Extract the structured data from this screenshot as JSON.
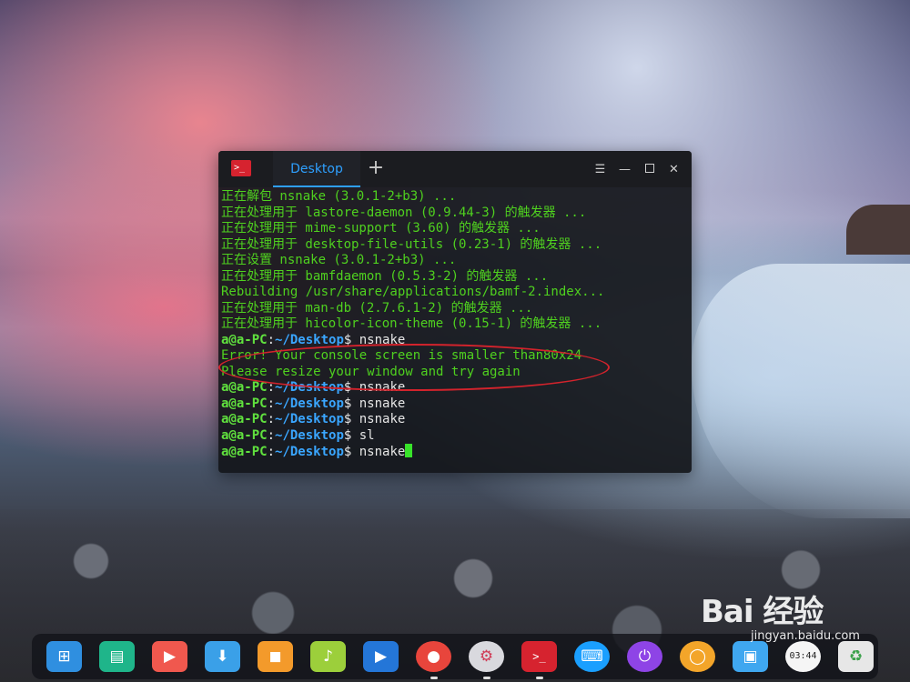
{
  "terminal": {
    "tab_title": "Desktop",
    "add_tab": "+",
    "controls": {
      "menu": "☰",
      "minimize": "—",
      "close": "✕"
    },
    "output_lines": [
      "正在解包 nsnake (3.0.1-2+b3) ...",
      "正在处理用于 lastore-daemon (0.9.44-3) 的触发器 ...",
      "正在处理用于 mime-support (3.60) 的触发器 ...",
      "正在处理用于 desktop-file-utils (0.23-1) 的触发器 ...",
      "正在设置 nsnake (3.0.1-2+b3) ...",
      "正在处理用于 bamfdaemon (0.5.3-2) 的触发器 ...",
      "Rebuilding /usr/share/applications/bamf-2.index...",
      "正在处理用于 man-db (2.7.6.1-2) 的触发器 ...",
      "正在处理用于 hicolor-icon-theme (0.15-1) 的触发器 ..."
    ],
    "prompt_user": "a@a-PC",
    "prompt_sep": ":",
    "prompt_path": "~/Desktop",
    "prompt_symbol": "$ ",
    "session": [
      {
        "type": "prompt",
        "cmd": "nsnake"
      },
      {
        "type": "output",
        "text": "Error! Your console screen is smaller than80x24"
      },
      {
        "type": "output",
        "text": "Please resize your window and try again"
      },
      {
        "type": "prompt",
        "cmd": "nsnake"
      },
      {
        "type": "prompt",
        "cmd": "nsnake"
      },
      {
        "type": "prompt",
        "cmd": "nsnake"
      },
      {
        "type": "prompt",
        "cmd": "sl"
      },
      {
        "type": "prompt",
        "cmd": "nsnake",
        "cursor": true
      }
    ]
  },
  "dock": {
    "items": [
      {
        "name": "launcher",
        "icon": "grid-icon",
        "color": "#2f8fe0",
        "glyph": "⊞"
      },
      {
        "name": "file-manager",
        "icon": "folder-icon",
        "color": "#1fb58a",
        "glyph": "▤"
      },
      {
        "name": "screen-recorder",
        "icon": "recorder-icon",
        "color": "#f0584e",
        "glyph": "▶"
      },
      {
        "name": "app-store",
        "icon": "store-icon",
        "color": "#3aa0e8",
        "glyph": "⬇"
      },
      {
        "name": "shop",
        "icon": "bag-icon",
        "color": "#f39a2b",
        "glyph": "◼"
      },
      {
        "name": "music",
        "icon": "music-icon",
        "color": "#9ccf3b",
        "glyph": "♪"
      },
      {
        "name": "video",
        "icon": "film-icon",
        "color": "#2476d8",
        "glyph": "▶"
      },
      {
        "name": "chrome",
        "icon": "chrome-icon",
        "color": "#e8453c",
        "glyph": "●"
      },
      {
        "name": "settings",
        "icon": "gear-icon",
        "color": "#d9d9de",
        "glyph": "⚙"
      },
      {
        "name": "terminal",
        "icon": "terminal-icon",
        "color": "#d6232f",
        "glyph": ">_"
      },
      {
        "name": "input-method",
        "icon": "keyboard-icon",
        "color": "#1a9fff",
        "glyph": "⌨"
      },
      {
        "name": "shutdown",
        "icon": "power-icon",
        "color": "#8e44e6",
        "glyph": "⏻"
      },
      {
        "name": "browser",
        "icon": "orange-circle-icon",
        "color": "#f3a52a",
        "glyph": "◯"
      },
      {
        "name": "image-viewer",
        "icon": "picture-icon",
        "color": "#3fa7f0",
        "glyph": "▣"
      },
      {
        "name": "clock",
        "icon": "clock-icon",
        "color": "#f5f5f5",
        "glyph": "03:44"
      },
      {
        "name": "trash",
        "icon": "trash-icon",
        "color": "#e7e7e7",
        "glyph": "♻"
      }
    ]
  },
  "watermark": {
    "main": "Bai 经验",
    "sub": "jingyan.baidu.com"
  }
}
